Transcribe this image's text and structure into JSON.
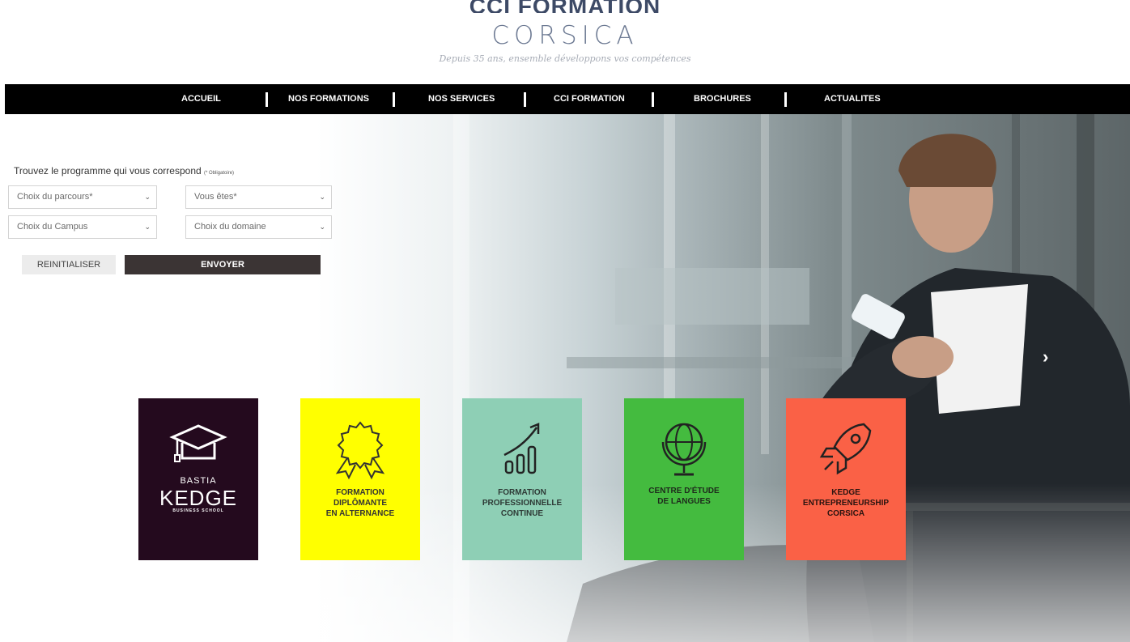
{
  "header": {
    "brand_line1": "CCI FORMATION",
    "brand_line2": "CORSICA",
    "tagline": "Depuis 35 ans, ensemble développons vos compétences"
  },
  "nav": {
    "items": [
      {
        "label": "ACCUEIL"
      },
      {
        "label": "NOS FORMATIONS"
      },
      {
        "label": "NOS SERVICES"
      },
      {
        "label": "CCI FORMATION"
      },
      {
        "label": "BROCHURES"
      },
      {
        "label": "ACTUALITES"
      }
    ]
  },
  "search": {
    "title": "Trouvez le programme qui vous correspond",
    "required_note": "(* Obligatoire)",
    "parcours": "Choix du parcours*",
    "profile": "Vous êtes*",
    "campus": "Choix du Campus",
    "domaine": "Choix du domaine",
    "reset_label": "REINITIALISER",
    "submit_label": "ENVOYER"
  },
  "slider": {
    "next_icon": "chevron-right-icon"
  },
  "tiles": {
    "kedge": {
      "city": "BASTIA",
      "name": "KEDGE",
      "sub": "BUSINESS SCHOOL",
      "icon": "graduation-cap-icon",
      "color": "#240a1e"
    },
    "alternance": {
      "text": "FORMATION\nDIPLÔMANTE\nEN ALTERNANCE",
      "icon": "award-ribbon-icon",
      "color": "#ffff00"
    },
    "continue": {
      "text": "FORMATION\nPROFESSIONNELLE\nCONTINUE",
      "icon": "growth-chart-icon",
      "color": "#8ecfb5"
    },
    "langues": {
      "text": "CENTRE D'ÉTUDE\nDE LANGUES",
      "icon": "globe-icon",
      "color": "#44bb3f"
    },
    "entrepreneurship": {
      "text": "KEDGE\nENTREPRENEURSHIP\nCORSICA",
      "icon": "rocket-icon",
      "color": "#fa6146"
    }
  }
}
